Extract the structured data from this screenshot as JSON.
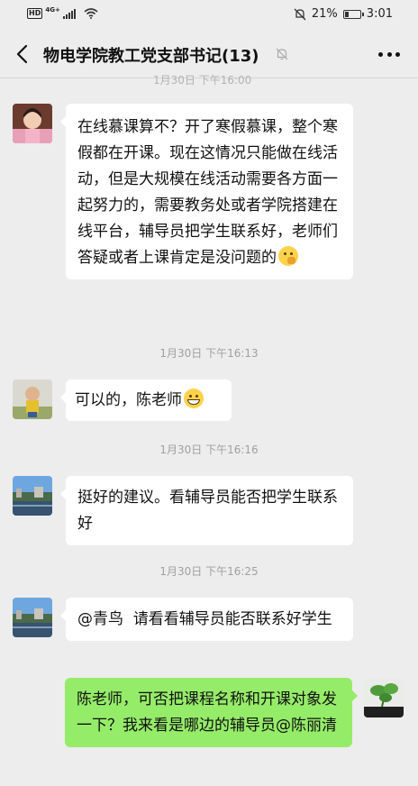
{
  "status_bar": {
    "hd": "HD",
    "network": "4G+",
    "battery": "21%",
    "time": "3:01"
  },
  "chat": {
    "title": "物电学院教工党支部书记(13)",
    "partial_time_above": "1月30日 下午16:00"
  },
  "messages": [
    {
      "side": "left",
      "text": "在线慕课算不？开了寒假慕课，整个寒假都在开课。现在这情况只能做在线活动，但是大规模在线活动需要各方面一起努力的，需要教务处或者学院搭建在线平台，辅导员把学生联系好，老师们答疑或者上课肯定是没问题的",
      "emoji": "thinking-emoji"
    },
    {
      "side": "left",
      "text": "可以的，陈老师",
      "emoji": "grin-emoji"
    },
    {
      "side": "left",
      "text": "挺好的建议。看辅导员能否把学生联系好"
    },
    {
      "side": "left",
      "text": "@青鸟  请看看辅导员能否联系好学生"
    },
    {
      "side": "right",
      "text": "陈老师，可否把课程名称和开课对象发一下？我来看是哪边的辅导员@陈丽清"
    }
  ],
  "timestamps": [
    "1月30日 下午16:13",
    "1月30日 下午16:16",
    "1月30日 下午16:25"
  ],
  "colors": {
    "background": "#ededed",
    "bubble_left": "#ffffff",
    "bubble_right": "#95ec69",
    "timestamp": "#a0a0a0"
  }
}
